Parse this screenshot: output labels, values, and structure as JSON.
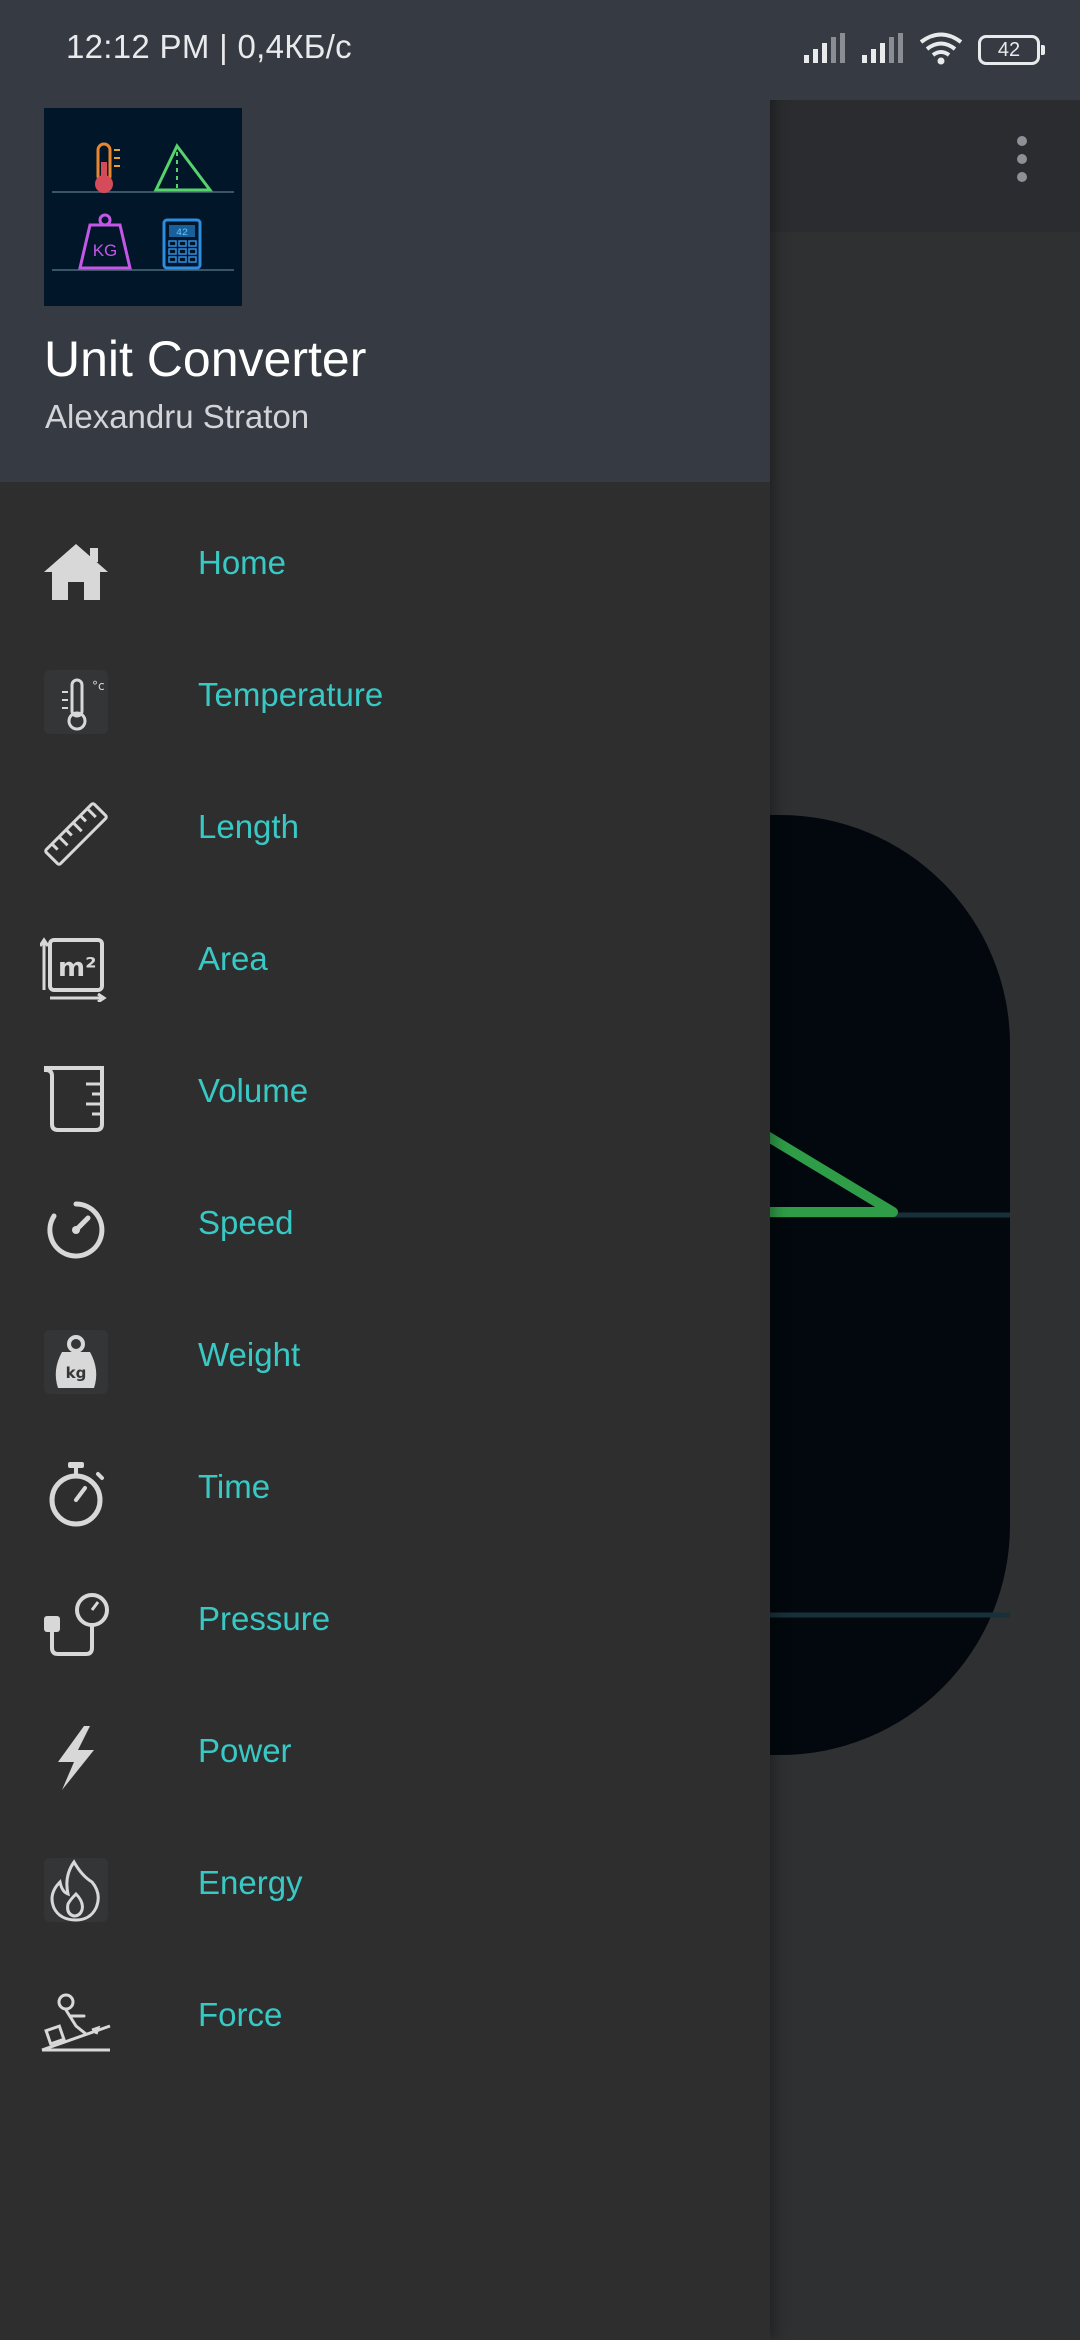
{
  "status_bar": {
    "time": "12:12 PM | 0,4КБ/с",
    "battery": "42",
    "icons": [
      "signal-icon",
      "signal-icon",
      "wifi-icon",
      "battery-icon"
    ]
  },
  "drawer": {
    "title": "Unit Converter",
    "author": "Alexandru Straton",
    "logo_digits": "42",
    "logo_kg": "KG",
    "items": [
      {
        "label": "Home",
        "icon": "home-icon"
      },
      {
        "label": "Temperature",
        "icon": "thermometer-icon"
      },
      {
        "label": "Length",
        "icon": "ruler-icon"
      },
      {
        "label": "Area",
        "icon": "area-icon"
      },
      {
        "label": "Volume",
        "icon": "beaker-icon"
      },
      {
        "label": "Speed",
        "icon": "speedometer-icon"
      },
      {
        "label": "Weight",
        "icon": "weight-icon"
      },
      {
        "label": "Time",
        "icon": "stopwatch-icon"
      },
      {
        "label": "Pressure",
        "icon": "pressure-gauge-icon"
      },
      {
        "label": "Power",
        "icon": "lightning-icon"
      },
      {
        "label": "Energy",
        "icon": "flame-icon"
      },
      {
        "label": "Force",
        "icon": "force-icon"
      }
    ]
  },
  "colors": {
    "accent": "#39c9c5",
    "drawer_bg": "#2e2e2f",
    "header_bg": "#363a42"
  }
}
